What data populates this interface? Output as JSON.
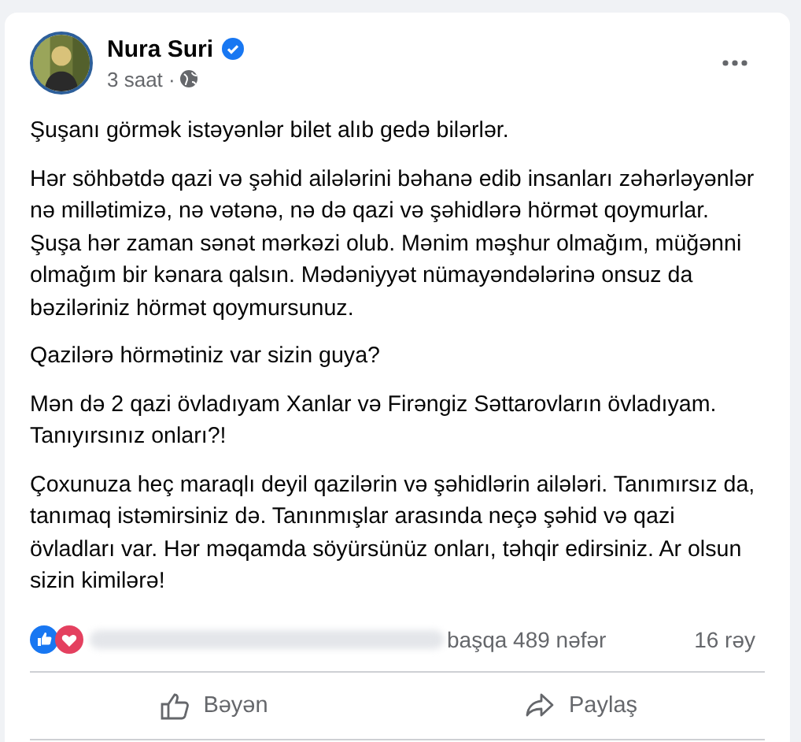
{
  "post": {
    "author": "Nura Suri",
    "verified": true,
    "time": "3 saat ·",
    "paragraphs": [
      "Şuşanı görmək istəyənlər bilet alıb gedə bilərlər.",
      "Hər söhbətdə qazi və şəhid ailələrini bəhanə edib insanları zəhərləyənlər nə millətimizə, nə vətənə, nə də qazi və şəhidlərə hörmət qoymurlar.\nŞuşa hər zaman sənət mərkəzi olub. Mənim məşhur olmağım, müğənni olmağım bir kənara qalsın. Mədəniyyət nümayəndələrinə onsuz da bəziləriniz hörmət qoymursunuz.",
      "Qazilərə hörmətiniz var sizin guya?",
      "Mən də 2 qazi övladıyam Xanlar və Firəngiz Səttarovların övladıyam.\nTanıyırsınız onları?!",
      "Çoxunuza heç maraqlı deyil qazilərin və şəhidlərin ailələri. Tanımırsız da, tanımaq istəmirsiniz də. Tanınmışlar arasında neçə şəhid və qazi övladları var. Hər məqamda söyürsünüz onları, təhqir edirsiniz. Ar olsun sizin kimilərə!"
    ],
    "reactions": {
      "others": "başqa 489 nəfər",
      "comments": "16 rəy"
    },
    "actions": [
      {
        "kind": "like",
        "label": "Bəyən"
      },
      {
        "kind": "share",
        "label": "Paylaş"
      }
    ]
  }
}
